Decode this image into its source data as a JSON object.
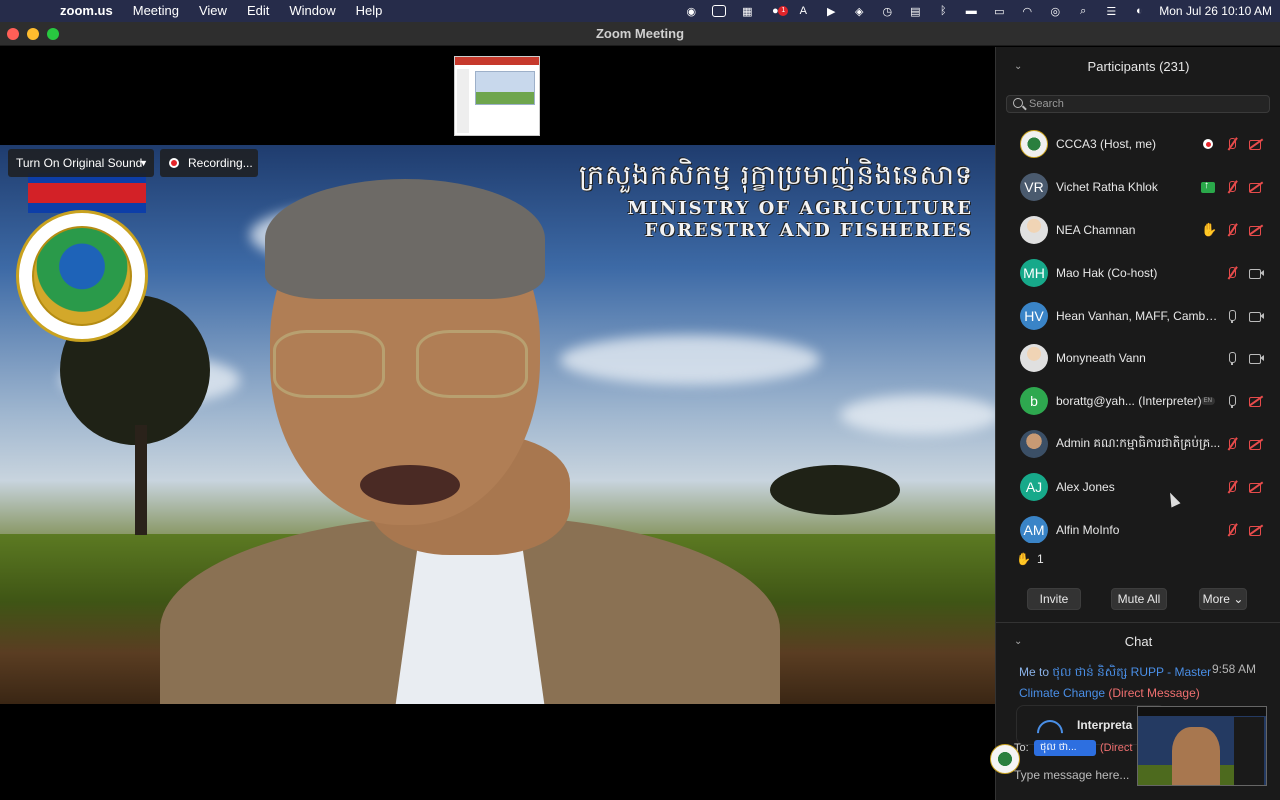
{
  "menubar": {
    "app": "zoom.us",
    "items": [
      "Meeting",
      "View",
      "Edit",
      "Window",
      "Help"
    ],
    "clock": "Mon Jul 26  10:10 AM"
  },
  "window": {
    "title": "Zoom Meeting"
  },
  "video": {
    "ministry_khmer": "ក្រសួងកសិកម្ម រុក្ខាប្រមាញ់និងនេសាទ",
    "ministry_line1": "MINISTRY OF AGRICULTURE",
    "ministry_line2": "FORESTRY AND FISHERIES",
    "original_sound_label": "Turn On Original Sound",
    "recording_label": "Recording..."
  },
  "participants": {
    "header": "Participants (231)",
    "search_placeholder": "Search",
    "list": [
      {
        "name": "CCCA3 (Host, me)",
        "initials": "",
        "avatar": "logo",
        "icons": [
          "rec-dot",
          "mic-off",
          "cam-off"
        ]
      },
      {
        "name": "Vichet Ratha Khlok",
        "initials": "VR",
        "avatar_color": "#4a5a6e",
        "icons": [
          "share-up",
          "mic-off",
          "cam-off"
        ]
      },
      {
        "name": "NEA Chamnan",
        "initials": "",
        "avatar": "img",
        "icons": [
          "hand",
          "mic-off",
          "cam-off"
        ]
      },
      {
        "name": "Mao Hak (Co-host)",
        "initials": "MH",
        "avatar_color": "#17a98a",
        "icons": [
          "mic-off",
          "cam-on"
        ]
      },
      {
        "name": "Hean Vanhan, MAFF, Cambo...",
        "initials": "HV",
        "avatar_color": "#3a84c7",
        "icons": [
          "mic-on",
          "cam-on"
        ]
      },
      {
        "name": "Monyneath Vann",
        "initials": "",
        "avatar": "img",
        "icons": [
          "mic-on",
          "cam-on"
        ]
      },
      {
        "name": "borattg@yah...  (Interpreter)",
        "initials": "b",
        "avatar_color": "#2ea84f",
        "badge": "EN",
        "icons": [
          "mic-on",
          "cam-off"
        ]
      },
      {
        "name": "Admin គណៈកម្មាធិការជាតិគ្រប់គ្រ...",
        "initials": "",
        "avatar": "person2",
        "icons": [
          "mic-off",
          "cam-off"
        ]
      },
      {
        "name": "Alex Jones",
        "initials": "AJ",
        "avatar_color": "#17a98a",
        "icons": [
          "mic-off",
          "cam-off"
        ]
      },
      {
        "name": "Alfin MoInfo",
        "initials": "AM",
        "avatar_color": "#3a84c7",
        "icons": [
          "mic-off",
          "cam-off"
        ]
      }
    ],
    "raised_hands": "1",
    "invite": "Invite",
    "mute_all": "Mute All",
    "more": "More"
  },
  "chat": {
    "header": "Chat",
    "message_prefix": "Me to ",
    "message_recipient": "ថុល ថាន់ និសិត្ស RUPP - Master Climate Change",
    "message_tag": "(Direct Message)",
    "message_time": "9:58 AM",
    "interpreter_label": "Interpreta",
    "to_label": "To:",
    "to_chip": "ថុល ថា...",
    "to_direct": "(Direct",
    "input_placeholder": "Type message here..."
  }
}
